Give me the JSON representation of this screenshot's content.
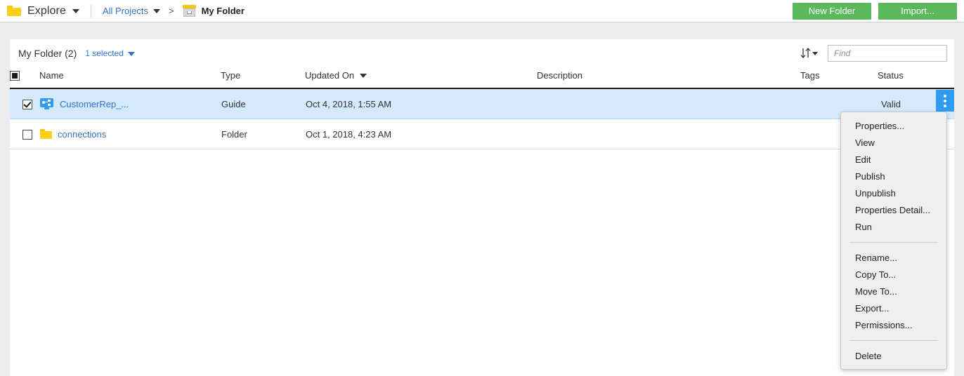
{
  "topbar": {
    "app_icon": "folder-icon",
    "app_label": "Explore",
    "breadcrumb": {
      "root_label": "All Projects",
      "separator": ">",
      "current_icon": "archive-box-icon",
      "current_label": "My Folder"
    },
    "buttons": {
      "new_folder": "New Folder",
      "import": "Import..."
    },
    "accent_green": "#5cb85c",
    "link_blue": "#2f73c9"
  },
  "panel": {
    "title": "My Folder (2)",
    "selected_label": "1 selected",
    "sort_icon": "sort-arrows-icon",
    "find": {
      "value": "",
      "placeholder": "Find"
    },
    "table": {
      "columns": [
        {
          "key": "check",
          "label": ""
        },
        {
          "key": "name",
          "label": "Name"
        },
        {
          "key": "type",
          "label": "Type"
        },
        {
          "key": "updated",
          "label": "Updated On",
          "sorted": true
        },
        {
          "key": "description",
          "label": "Description"
        },
        {
          "key": "tags",
          "label": "Tags"
        },
        {
          "key": "status",
          "label": "Status"
        }
      ],
      "rows": [
        {
          "selected": true,
          "checked": true,
          "icon": "guide-monitor-icon",
          "name": "CustomerRep_...",
          "type": "Guide",
          "updated": "Oct 4, 2018, 1:55 AM",
          "description": "",
          "tags": "",
          "status": "Valid"
        },
        {
          "selected": false,
          "checked": false,
          "icon": "folder-icon",
          "name": "connections",
          "type": "Folder",
          "updated": "Oct 1, 2018, 4:23 AM",
          "description": "",
          "tags": "",
          "status": ""
        }
      ]
    },
    "row_menu_button": "row-actions-kebab",
    "selected_row_color": "#d4e9fb"
  },
  "context_menu": {
    "groups": [
      {
        "items": [
          "Properties...",
          "View",
          "Edit",
          "Publish",
          "Unpublish",
          "Properties Detail...",
          "Run"
        ]
      },
      {
        "items": [
          "Rename...",
          "Copy To...",
          "Move To...",
          "Export...",
          "Permissions..."
        ]
      },
      {
        "items": [
          "Delete"
        ]
      }
    ]
  }
}
